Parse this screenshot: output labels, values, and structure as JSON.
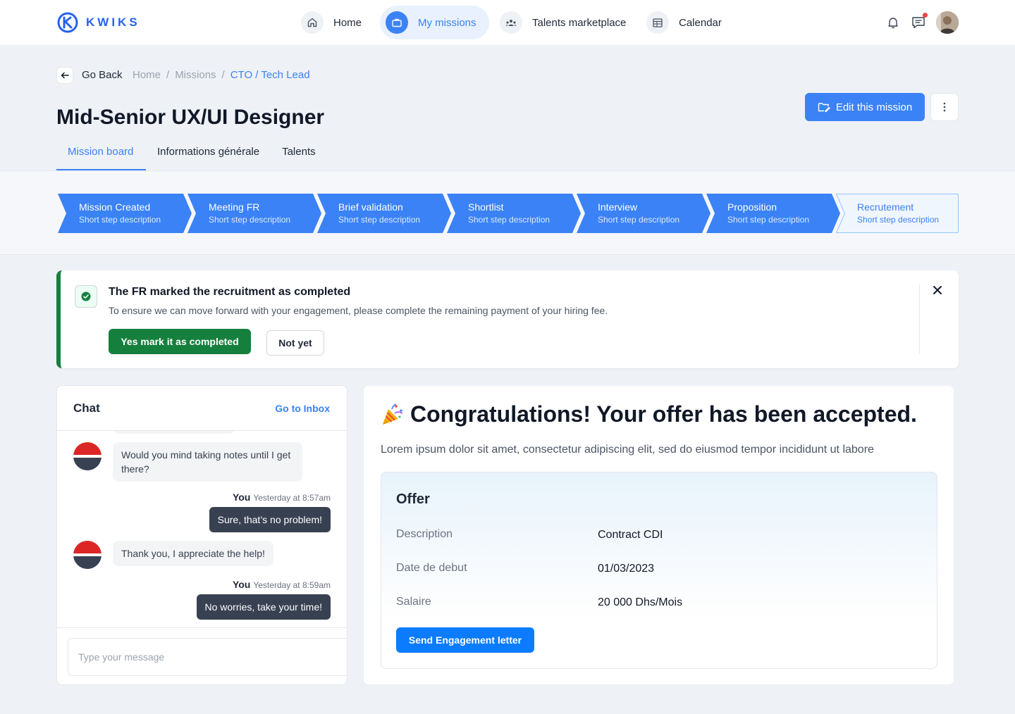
{
  "brand": {
    "name": "KWIKS",
    "color": "#2563eb"
  },
  "nav": {
    "items": [
      {
        "label": "Home",
        "icon": "home-icon",
        "active": false
      },
      {
        "label": "My missions",
        "icon": "briefcase-icon",
        "active": true
      },
      {
        "label": "Talents marketplace",
        "icon": "people-icon",
        "active": false
      },
      {
        "label": "Calendar",
        "icon": "calendar-icon",
        "active": false
      }
    ],
    "right_icons": [
      "bell-icon",
      "messages-icon",
      "avatar"
    ]
  },
  "page": {
    "back_label": "Go Back",
    "breadcrumb": [
      "Home",
      "/",
      "Missions",
      "/",
      "CTO / Tech Lead"
    ],
    "title": "Mid-Senior UX/UI Designer",
    "edit_button": "Edit this mission",
    "tabs": [
      "Mission board",
      "Informations générale",
      "Talents"
    ],
    "active_tab": "Mission board"
  },
  "steps": [
    {
      "title": "Mission Created",
      "desc": "Short step description",
      "status": "done"
    },
    {
      "title": "Meeting FR",
      "desc": "Short step description",
      "status": "done"
    },
    {
      "title": "Brief validation",
      "desc": "Short step description",
      "status": "done"
    },
    {
      "title": "Shortlist",
      "desc": "Short step description",
      "status": "done"
    },
    {
      "title": "Interview",
      "desc": "Short step description",
      "status": "done"
    },
    {
      "title": "Proposition",
      "desc": "Short step description",
      "status": "done"
    },
    {
      "title": "Recrutement",
      "desc": "Short step description",
      "status": "pending"
    }
  ],
  "alert": {
    "title": "The FR marked the recruitment as completed",
    "text": "To ensure we can move forward with your engagement, please complete the remaining payment of your hiring fee.",
    "yes_label": "Yes mark it as completed",
    "no_label": "Not yet",
    "accent": "#15803d"
  },
  "chat": {
    "title": "Chat",
    "inbox_link": "Go to Inbox",
    "messages": [
      {
        "from": "other",
        "text": "Would you mind taking notes until I get there?"
      },
      {
        "from": "you",
        "sender": "You",
        "time": "Yesterday at 8:57am",
        "text": "Sure, that’s no problem!"
      },
      {
        "from": "other",
        "text": "Thank you, I appreciate the help!"
      },
      {
        "from": "you",
        "sender": "You",
        "time": "Yesterday at 8:59am",
        "text": "No worries, take your time!"
      }
    ],
    "input_placeholder": "Type your message"
  },
  "congrats": {
    "title": "Congratulations! Your offer has been accepted.",
    "subtitle": "Lorem ipsum dolor sit amet, consectetur adipiscing elit, sed do eiusmod tempor incididunt ut labore",
    "offer": {
      "title": "Offer",
      "rows": [
        {
          "label": "Description",
          "value": "Contract CDI"
        },
        {
          "label": "Date de debut",
          "value": "01/03/2023"
        },
        {
          "label": "Salaire",
          "value": "20 000 Dhs/Mois"
        }
      ],
      "button": "Send Engagement letter"
    }
  }
}
